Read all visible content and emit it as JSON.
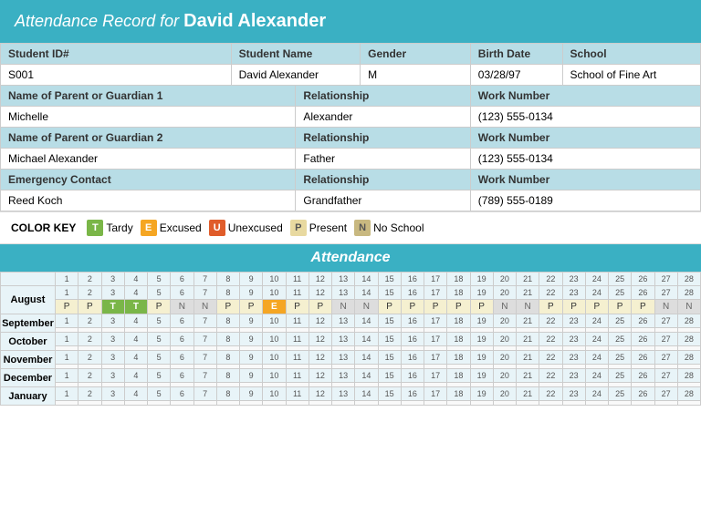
{
  "header": {
    "prefix": "Attendance Record for",
    "student_name": "David Alexander"
  },
  "student_info": {
    "fields": [
      {
        "label": "Student ID#",
        "value": "S001"
      },
      {
        "label": "Student Name",
        "value": "David Alexander"
      },
      {
        "label": "Gender",
        "value": "M"
      },
      {
        "label": "Birth Date",
        "value": "03/28/97"
      },
      {
        "label": "School",
        "value": "School of Fine Art"
      }
    ],
    "guardian1": {
      "name": "Michelle",
      "relationship": "Alexander",
      "work_number": "(123) 555-0134"
    },
    "guardian2": {
      "name": "Michael Alexander",
      "relationship": "Father",
      "work_number": "(123) 555-0134"
    },
    "emergency": {
      "name": "Reed Koch",
      "relationship": "Grandfather",
      "work_number": "(789) 555-0189"
    }
  },
  "color_key": {
    "label": "COLOR KEY",
    "items": [
      {
        "code": "T",
        "label": "Tardy",
        "class": "key-tardy"
      },
      {
        "code": "E",
        "label": "Excused",
        "class": "key-excused"
      },
      {
        "code": "U",
        "label": "Unexcused",
        "class": "key-unexcused"
      },
      {
        "code": "P",
        "label": "Present",
        "class": "key-present"
      },
      {
        "code": "N",
        "label": "No School",
        "class": "key-noschool"
      }
    ]
  },
  "attendance": {
    "title": "Attendance",
    "days": [
      1,
      2,
      3,
      4,
      5,
      6,
      7,
      8,
      9,
      10,
      11,
      12,
      13,
      14,
      15,
      16,
      17,
      18,
      19,
      20,
      21,
      22,
      23,
      24,
      25,
      26,
      27,
      28
    ],
    "months": [
      {
        "name": "August",
        "values": [
          "P",
          "P",
          "T",
          "T",
          "P",
          "N",
          "N",
          "P",
          "P",
          "E",
          "P",
          "P",
          "N",
          "N",
          "P",
          "P",
          "P",
          "P",
          "P",
          "N",
          "N",
          "P",
          "P",
          "P",
          "P",
          "P",
          "N",
          "N"
        ]
      },
      {
        "name": "September",
        "values": [
          "",
          "",
          "",
          "",
          "",
          "",
          "",
          "",
          "",
          "",
          "",
          "",
          "",
          "",
          "",
          "",
          "",
          "",
          "",
          "",
          "",
          "",
          "",
          "",
          "",
          "",
          "",
          ""
        ]
      },
      {
        "name": "October",
        "values": [
          "",
          "",
          "",
          "",
          "",
          "",
          "",
          "",
          "",
          "",
          "",
          "",
          "",
          "",
          "",
          "",
          "",
          "",
          "",
          "",
          "",
          "",
          "",
          "",
          "",
          "",
          "",
          ""
        ]
      },
      {
        "name": "November",
        "values": [
          "",
          "",
          "",
          "",
          "",
          "",
          "",
          "",
          "",
          "",
          "",
          "",
          "",
          "",
          "",
          "",
          "",
          "",
          "",
          "",
          "",
          "",
          "",
          "",
          "",
          "",
          "",
          ""
        ]
      },
      {
        "name": "December",
        "values": [
          "",
          "",
          "",
          "",
          "",
          "",
          "",
          "",
          "",
          "",
          "",
          "",
          "",
          "",
          "",
          "",
          "",
          "",
          "",
          "",
          "",
          "",
          "",
          "",
          "",
          "",
          "",
          ""
        ]
      },
      {
        "name": "January",
        "values": [
          "",
          "",
          "",
          "",
          "",
          "",
          "",
          "",
          "",
          "",
          "",
          "",
          "",
          "",
          "",
          "",
          "",
          "",
          "",
          "",
          "",
          "",
          "",
          "",
          "",
          "",
          "",
          ""
        ]
      }
    ]
  }
}
